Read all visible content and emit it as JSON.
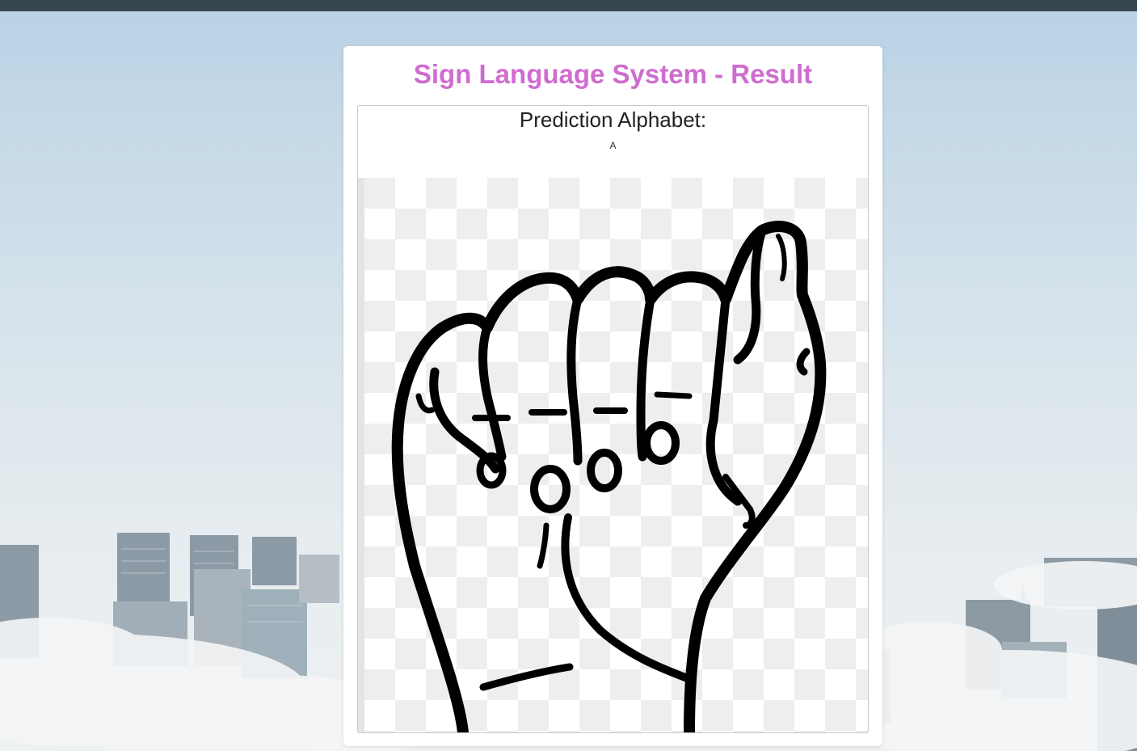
{
  "page": {
    "title": "Sign Language System - Result",
    "title_color": "#d06ccf",
    "topbar_color": "#37474f"
  },
  "result": {
    "label": "Prediction Alphabet:",
    "value": "A",
    "image": {
      "icon": "asl-hand-sign-a-image"
    }
  }
}
